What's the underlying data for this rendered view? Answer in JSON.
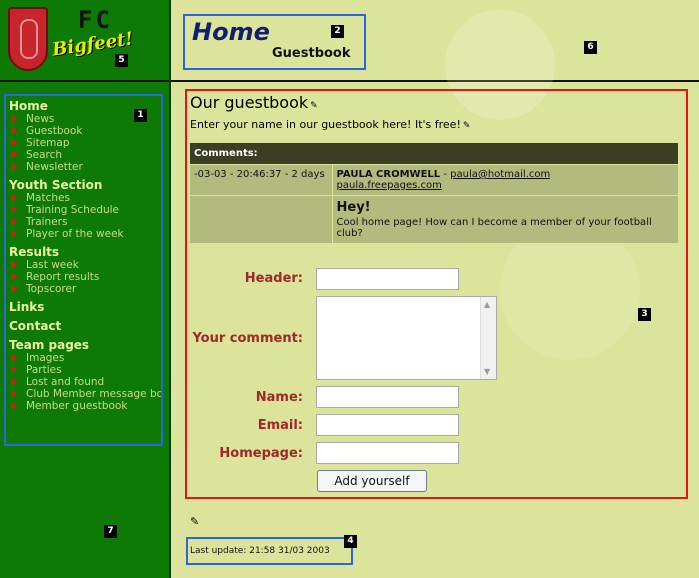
{
  "logo": {
    "line1": "FC",
    "line2": "Bigfeet!"
  },
  "header": {
    "title": "Home",
    "subtitle": "Guestbook"
  },
  "nav": {
    "sections": [
      {
        "label": "Home",
        "items": [
          "News",
          "Guestbook",
          "Sitemap",
          "Search",
          "Newsletter"
        ]
      },
      {
        "label": "Youth Section",
        "items": [
          "Matches",
          "Training Schedule",
          "Trainers",
          "Player of the week"
        ]
      },
      {
        "label": "Results",
        "items": [
          "Last week",
          "Report results",
          "Topscorer"
        ]
      },
      {
        "label": "Links",
        "items": []
      },
      {
        "label": "Contact",
        "items": []
      },
      {
        "label": "Team pages",
        "items": [
          "Images",
          "Parties",
          "Lost and found",
          "Club Member message bo",
          "Member guestbook"
        ]
      }
    ]
  },
  "guestbook": {
    "title": "Our guestbook",
    "intro": "Enter your name in our guestbook here! It's free!",
    "comments_header": "Comments:",
    "entries": [
      {
        "datetime": "-03-03 - 20:46:37 - 2 days",
        "name": "PAULA CROMWELL",
        "separator": " - ",
        "email": "paula@hotmail.com",
        "website": "paula.freepages.com",
        "header": "Hey!",
        "message": "Cool home page! How can I become a member of your football club?"
      }
    ]
  },
  "form": {
    "header_label": "Header:",
    "comment_label": "Your comment:",
    "name_label": "Name:",
    "email_label": "Email:",
    "homepage_label": "Homepage:",
    "submit_label": "Add yourself"
  },
  "footer": {
    "last_update": "Last update:  21:58 31/03 2003"
  },
  "annotations": [
    "1",
    "2",
    "3",
    "4",
    "5",
    "6",
    "7"
  ],
  "colors": {
    "sidebar": "#0d7a06",
    "background": "#dbe49a",
    "label_red": "#a02828",
    "title_blue": "#10206e"
  }
}
